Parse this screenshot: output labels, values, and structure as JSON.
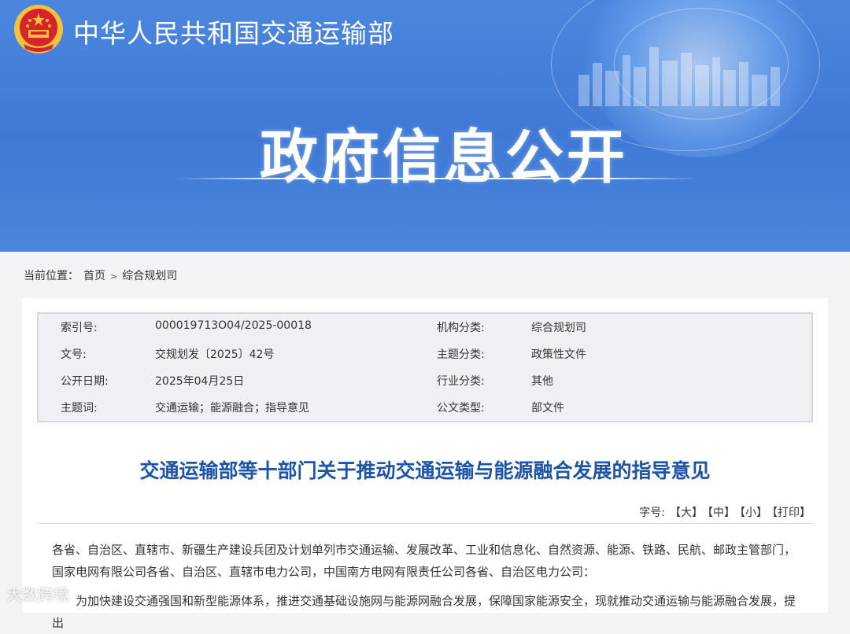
{
  "header": {
    "ministry_name": "中华人民共和国交通运输部",
    "section_title": "政府信息公开"
  },
  "breadcrumb": {
    "label": "当前位置：",
    "home": "首页",
    "separator": ">",
    "current": "综合规划司"
  },
  "metadata": {
    "rows": [
      {
        "k1": "索引号:",
        "v1": "000019713O04/2025-00018",
        "k2": "机构分类:",
        "v2": "综合规划司"
      },
      {
        "k1": "文号:",
        "v1": "交规划发〔2025〕42号",
        "k2": "主题分类:",
        "v2": "政策性文件"
      },
      {
        "k1": "公开日期:",
        "v1": "2025年04月25日",
        "k2": "行业分类:",
        "v2": "其他"
      },
      {
        "k1": "主题词:",
        "v1": "交通运输；能源融合；指导意见",
        "k2": "公文类型:",
        "v2": "部文件"
      }
    ]
  },
  "document": {
    "title": "交通运输部等十部门关于推动交通运输与能源融合发展的指导意见",
    "font_size": {
      "label": "字号:",
      "large": "【大】",
      "medium": "【中】",
      "small": "【小】",
      "print": "【打印】"
    },
    "paragraphs": [
      "各省、自治区、直辖市、新疆生产建设兵团及计划单列市交通运输、发展改革、工业和信息化、自然资源、能源、铁路、民航、邮政主管部门，国家电网有限公司各省、自治区、直辖市电力公司，中国南方电网有限责任公司各省、自治区电力公司：",
      "为加快建设交通强国和新型能源体系，推进交通基础设施网与能源网融合发展，保障国家能源安全，现就推动交通运输与能源融合发展，提出"
    ]
  },
  "watermark": "大数跨境",
  "colors": {
    "banner": "#4282dc",
    "title_blue": "#1c54a8",
    "emblem_red": "#d8232a",
    "emblem_gold": "#f3c33c"
  }
}
